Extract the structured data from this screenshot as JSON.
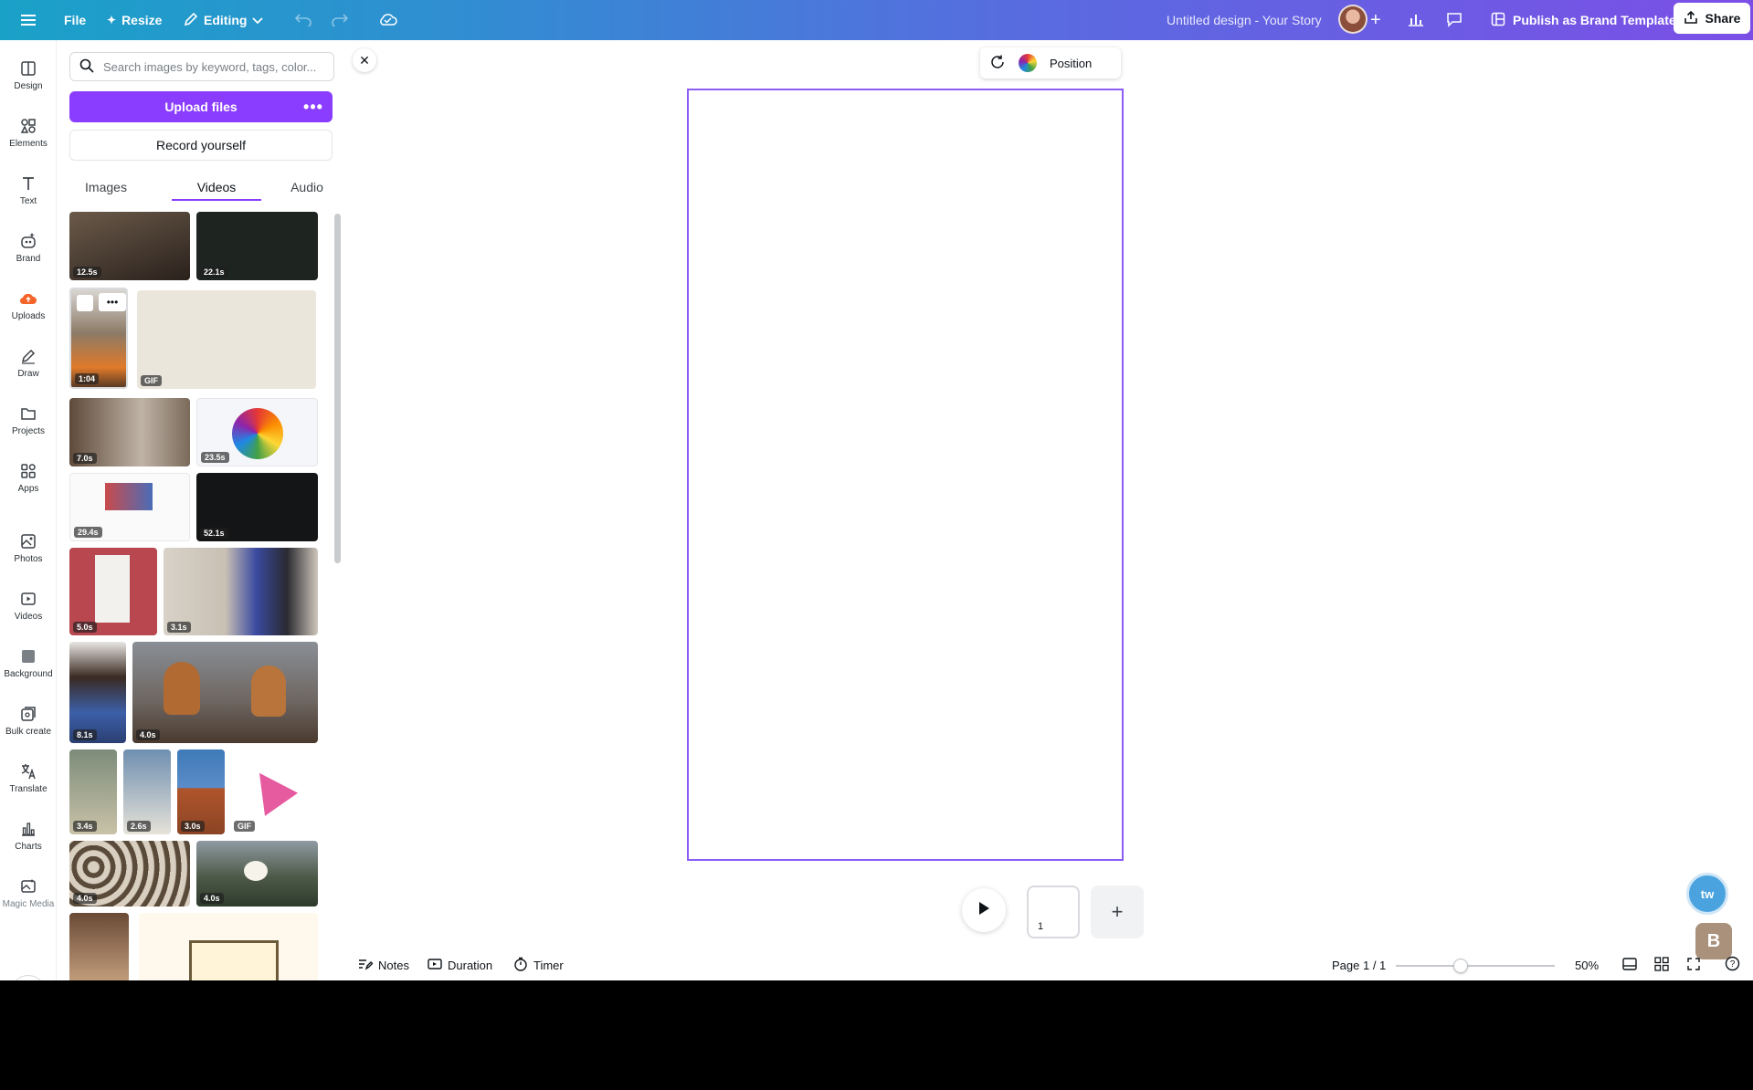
{
  "topbar": {
    "file_label": "File",
    "resize_label": "Resize",
    "editing_label": "Editing",
    "doc_title": "Untitled design - Your Story",
    "publish_label": "Publish as Brand Template",
    "share_label": "Share"
  },
  "rail": {
    "items": [
      {
        "label": "Design",
        "icon": "design-icon"
      },
      {
        "label": "Elements",
        "icon": "elements-icon"
      },
      {
        "label": "Text",
        "icon": "text-icon"
      },
      {
        "label": "Brand",
        "icon": "brand-icon"
      },
      {
        "label": "Uploads",
        "icon": "uploads-icon"
      },
      {
        "label": "Draw",
        "icon": "draw-icon"
      },
      {
        "label": "Projects",
        "icon": "projects-icon"
      },
      {
        "label": "Apps",
        "icon": "apps-icon"
      },
      {
        "label": "Photos",
        "icon": "photos-icon"
      },
      {
        "label": "Videos",
        "icon": "videos-icon"
      },
      {
        "label": "Background",
        "icon": "background-icon"
      },
      {
        "label": "Bulk create",
        "icon": "bulk-create-icon"
      },
      {
        "label": "Translate",
        "icon": "translate-icon"
      },
      {
        "label": "Charts",
        "icon": "charts-icon"
      },
      {
        "label": "Magic Media",
        "icon": "magic-media-icon"
      }
    ]
  },
  "panel": {
    "search_placeholder": "Search images by keyword, tags, color...",
    "upload_label": "Upload files",
    "record_label": "Record yourself",
    "tabs": [
      "Images",
      "Videos",
      "Audio"
    ],
    "active_tab": "Videos",
    "thumbs": [
      {
        "duration": "12.5s"
      },
      {
        "duration": "22.1s"
      },
      {
        "duration": "1:04"
      },
      {
        "duration": "GIF"
      },
      {
        "duration": "7.0s"
      },
      {
        "duration": "23.5s"
      },
      {
        "duration": "29.4s"
      },
      {
        "duration": "52.1s"
      },
      {
        "duration": "5.0s"
      },
      {
        "duration": "3.1s"
      },
      {
        "duration": "8.1s"
      },
      {
        "duration": "4.0s"
      },
      {
        "duration": "3.4s"
      },
      {
        "duration": "2.6s"
      },
      {
        "duration": "3.0s"
      },
      {
        "duration": "GIF"
      },
      {
        "duration": "4.0s"
      },
      {
        "duration": "4.0s"
      }
    ]
  },
  "canvas": {
    "position_label": "Position",
    "page_number": "1"
  },
  "badges": {
    "first": "tw",
    "second": "B"
  },
  "bottombar": {
    "notes_label": "Notes",
    "duration_label": "Duration",
    "timer_label": "Timer",
    "page_label": "Page 1 / 1",
    "zoom_label": "50%",
    "zoom_level_percent": 50
  },
  "colors": {
    "accent": "#8b3dff",
    "topbar_start": "#1aa1c8",
    "topbar_end": "#7b4fe6"
  }
}
